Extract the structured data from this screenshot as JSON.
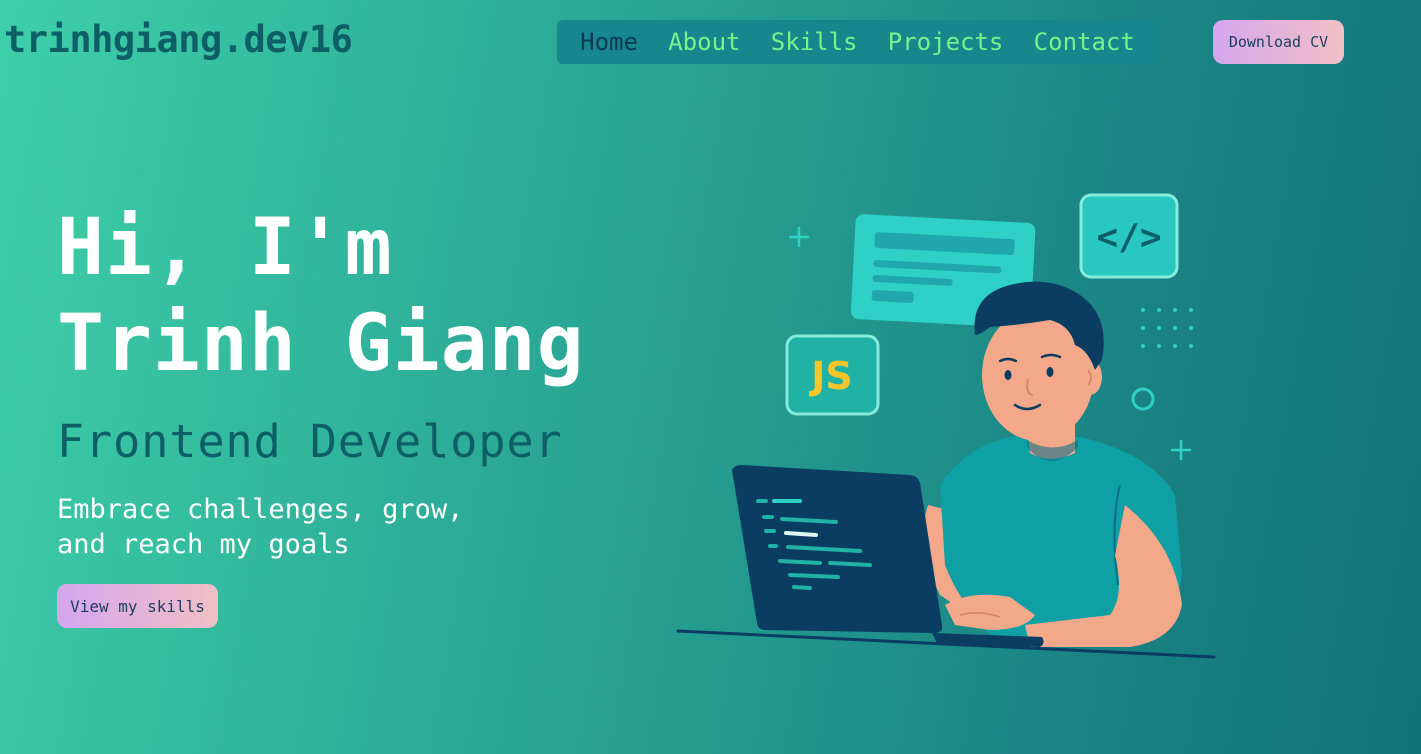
{
  "header": {
    "logo": "trinhgiang.dev16",
    "nav": [
      {
        "label": "Home",
        "active": true
      },
      {
        "label": "About",
        "active": false
      },
      {
        "label": "Skills",
        "active": false
      },
      {
        "label": "Projects",
        "active": false
      },
      {
        "label": "Contact",
        "active": false
      }
    ],
    "download_cv_label": "Download CV"
  },
  "hero": {
    "greeting": "Hi, I'm",
    "name": "Trinh Giang",
    "role": "Frontend Developer",
    "tagline": "Embrace challenges, grow, and reach my goals",
    "cta_label": "View my skills"
  },
  "illustration": {
    "js_badge": "JS",
    "code_badge": "</>"
  },
  "colors": {
    "nav_link": "#7af28c",
    "nav_active": "#0c3a52",
    "accent_dark": "#0e5e68",
    "button_gradient_start": "#d4a6ee",
    "button_gradient_end": "#f1c0c6"
  }
}
